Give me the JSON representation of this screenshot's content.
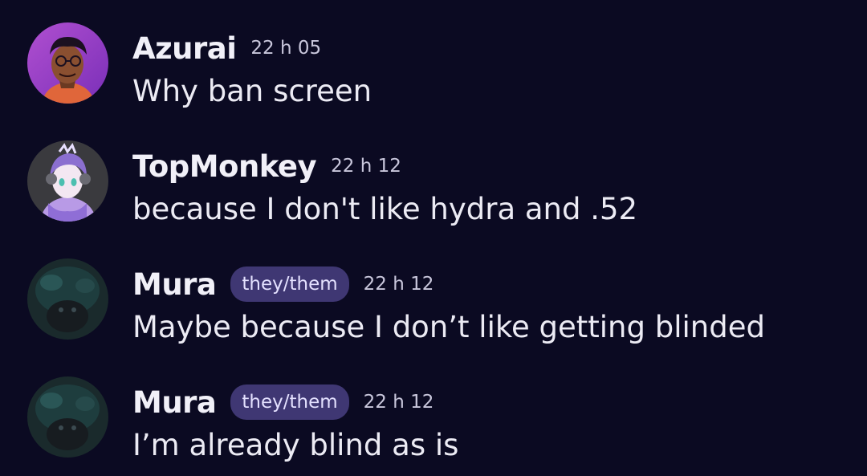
{
  "messages": [
    {
      "username": "Azurai",
      "pronouns": "",
      "time": "22 h 05",
      "text": "Why ban screen",
      "avatar_icon": "cartoon-man-avatar-icon"
    },
    {
      "username": "TopMonkey",
      "pronouns": "",
      "time": "22 h 12",
      "text": "because I don't like hydra and .52",
      "avatar_icon": "anime-character-avatar-icon"
    },
    {
      "username": "Mura",
      "pronouns": "they/them",
      "time": "22 h 12",
      "text": "Maybe because I don’t like getting blinded",
      "avatar_icon": "dark-teal-avatar-icon"
    },
    {
      "username": "Mura",
      "pronouns": "they/them",
      "time": "22 h 12",
      "text": "I’m already blind as is",
      "avatar_icon": "dark-teal-avatar-icon"
    }
  ],
  "colors": {
    "background": "#0b0a22",
    "pronoun_badge": "#3f3773",
    "text": "#ecebf4",
    "timestamp": "#c9c7dc"
  }
}
